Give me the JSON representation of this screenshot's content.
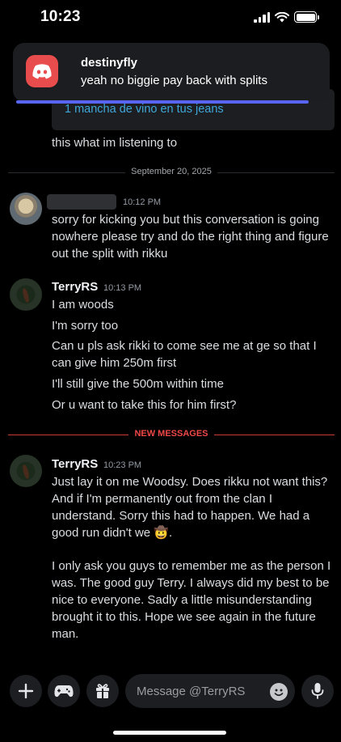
{
  "status_bar": {
    "time": "10:23"
  },
  "notification": {
    "app_icon": "discord-logo",
    "title": "destinyfly",
    "body": "yeah no biggie pay back with splits"
  },
  "embed": {
    "link_text": "1 mancha de vino en tus jeans"
  },
  "previous_message": {
    "text": "this what im listening to"
  },
  "date_divider": {
    "label": "September 20, 2025"
  },
  "messages": [
    {
      "author": "",
      "timestamp": "10:12 PM",
      "lines": [
        "sorry for kicking you but this conversation is going nowhere please try and do the right thing and figure out the split with rikku"
      ]
    },
    {
      "author": "TerryRS",
      "timestamp": "10:13 PM",
      "lines": [
        "I am woods",
        "I'm sorry too",
        "Can u pls ask rikki to come see me at ge so that I can give him 250m first",
        "I'll still give the 500m within time",
        "Or u want to take this for him first?"
      ]
    },
    {
      "author": "TerryRS",
      "timestamp": "10:23 PM",
      "lines": [
        "Just lay it on me Woodsy. Does rikku not want this? And if I'm permanently out from the clan I understand. Sorry this had to happen. We had a good run didn't we 🤠.",
        "I only ask you guys to remember me as the person I was. The good guy Terry. I always did my best to be nice to everyone. Sadly a little misunderstanding brought it to this. Hope we see again in the future man."
      ]
    }
  ],
  "new_messages_divider": {
    "label": "NEW MESSAGES"
  },
  "composer": {
    "placeholder": "Message @TerryRS",
    "buttons": [
      "plus-icon",
      "gamepad-icon",
      "gift-icon",
      "emoji-icon",
      "microphone-icon"
    ]
  },
  "colors": {
    "accent": "#5865f2",
    "discord_red": "#e94c4c",
    "link": "#3ea7d9",
    "new_messages": "#f04747"
  }
}
